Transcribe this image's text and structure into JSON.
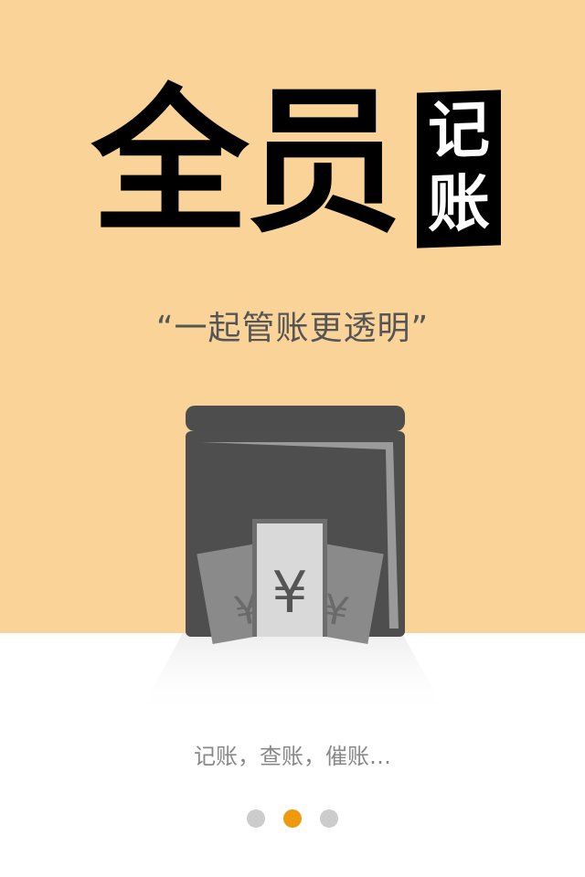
{
  "hero": {
    "title": "全员",
    "badge_line1": "记",
    "badge_line2": "账",
    "tagline": "“一起管账更透明”",
    "currency_symbol": "¥"
  },
  "caption": "记账，查账，催账…",
  "pager": {
    "total": 3,
    "active_index": 1
  },
  "colors": {
    "background_top": "#f9d398",
    "background_bottom": "#ffffff",
    "pager_active": "#f0990f",
    "pager_inactive": "#cccccc"
  }
}
